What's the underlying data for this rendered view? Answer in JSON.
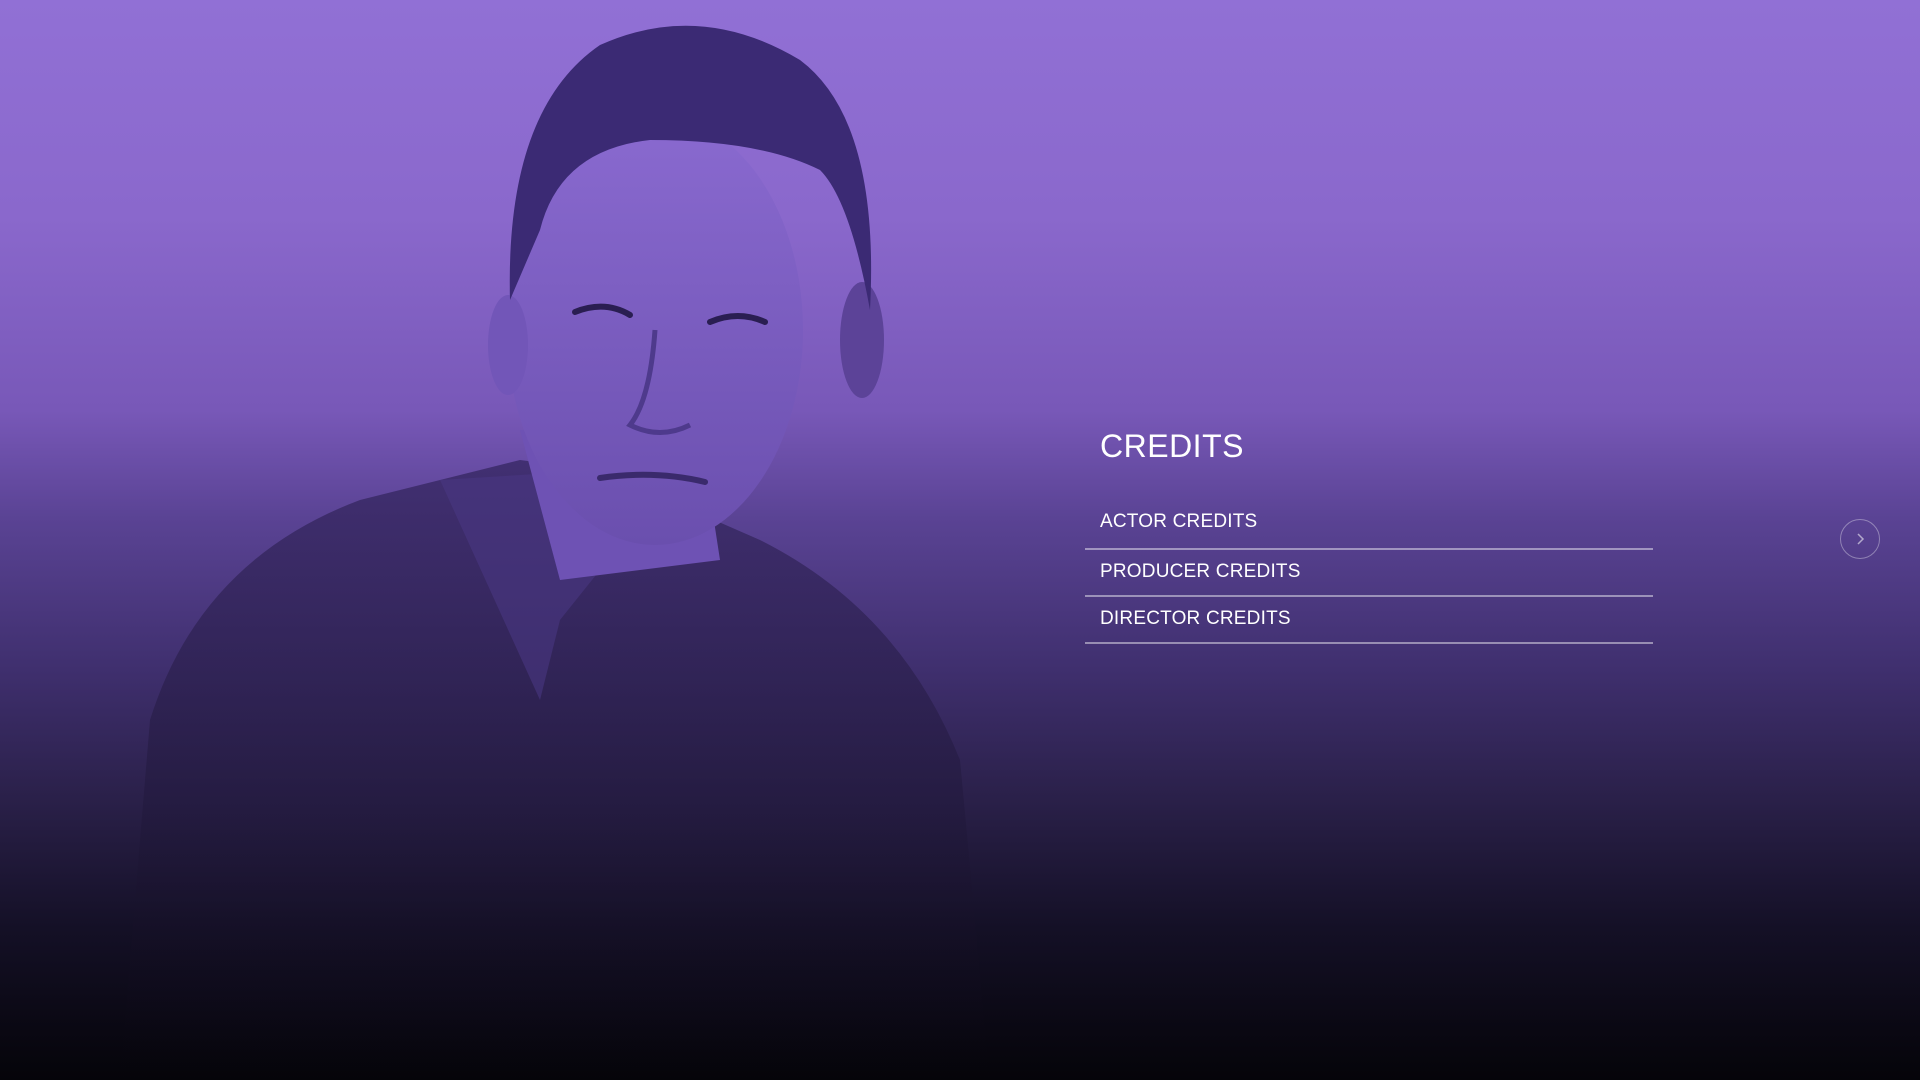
{
  "credits": {
    "title": "CREDITS",
    "items": [
      {
        "label": "ACTOR CREDITS"
      },
      {
        "label": "PRODUCER CREDITS"
      },
      {
        "label": "DIRECTOR CREDITS"
      }
    ]
  },
  "navigation": {
    "next_icon": "chevron-right-icon"
  },
  "colors": {
    "background_top": "#9170d5",
    "background_bottom": "#050409",
    "text": "#ffffff"
  }
}
